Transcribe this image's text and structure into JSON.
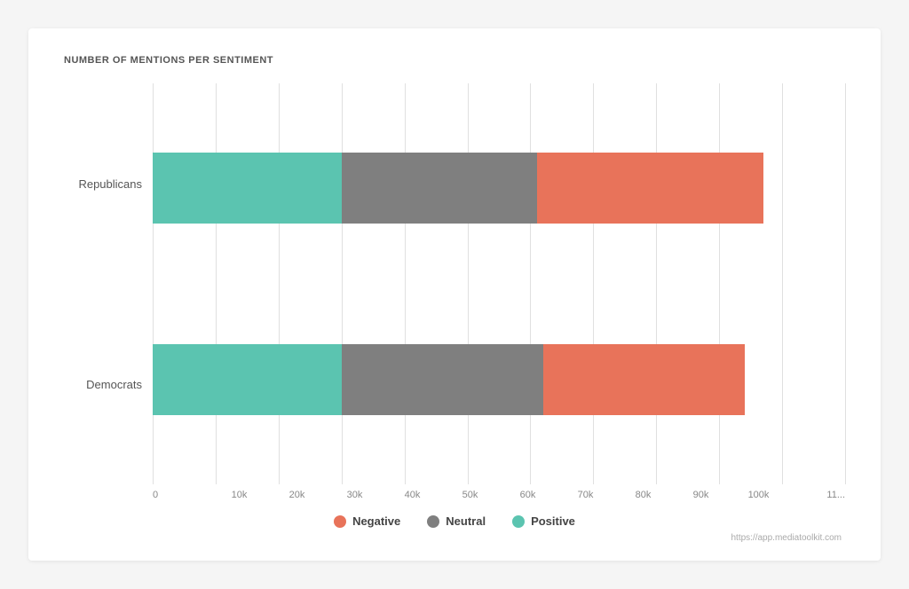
{
  "chart": {
    "title": "NUMBER OF MENTIONS PER SENTIMENT",
    "max_value": 110000,
    "x_ticks": [
      "0",
      "10k",
      "20k",
      "30k",
      "40k",
      "50k",
      "60k",
      "70k",
      "80k",
      "90k",
      "100k",
      "11..."
    ],
    "grid_positions_pct": [
      0,
      9.09,
      18.18,
      27.27,
      36.36,
      45.45,
      54.55,
      63.64,
      72.73,
      81.82,
      90.91,
      100
    ],
    "series": [
      {
        "label": "Republicans",
        "positive": 30000,
        "neutral": 31000,
        "negative": 36000
      },
      {
        "label": "Democrats",
        "positive": 30000,
        "neutral": 32000,
        "negative": 32000
      }
    ],
    "legend": [
      {
        "key": "negative",
        "label": "Negative",
        "color": "#e8735a"
      },
      {
        "key": "neutral",
        "label": "Neutral",
        "color": "#7f7f7f"
      },
      {
        "key": "positive",
        "label": "Positive",
        "color": "#5bc4b0"
      }
    ],
    "attribution": "https://app.mediatoolkit.com"
  }
}
